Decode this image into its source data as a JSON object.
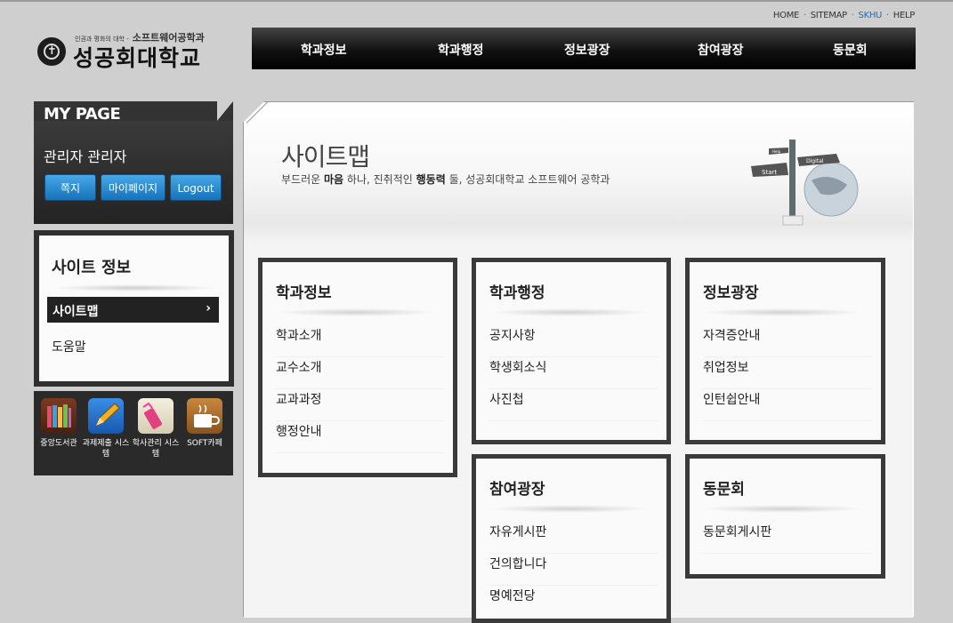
{
  "util": {
    "home": "HOME",
    "sitemap": "SITEMAP",
    "skhu": "SKHU",
    "help": "HELP",
    "sep": "·"
  },
  "logo": {
    "tagline_small": "인권과 평화의 대학 -",
    "tagline_dept": "소프트웨어공학과",
    "name": "성공회대학교"
  },
  "gnb": [
    "학과정보",
    "학과행정",
    "정보광장",
    "참여광장",
    "동문회"
  ],
  "mypage": {
    "title": "MY PAGE",
    "user": "관리자 관리자",
    "btn_note": "쪽지",
    "btn_mypage": "마이페이지",
    "btn_logout": "Logout"
  },
  "siteinfo": {
    "title": "사이트 정보",
    "active": "사이트맵",
    "chevron": "›",
    "help": "도움말"
  },
  "quick": [
    {
      "icon": "library-books-icon",
      "caption": "중앙도서관"
    },
    {
      "icon": "pencil-icon",
      "caption": "과제제출 시스템"
    },
    {
      "icon": "highlighter-icon",
      "caption": "학사관리 시스템"
    },
    {
      "icon": "coffee-cup-icon",
      "caption": "SOFT카페"
    }
  ],
  "hero": {
    "title": "사이트맵",
    "sub_prefix": "부드러운",
    "sub_b1": "마음",
    "sub_mid": "하나, 진취적인",
    "sub_b2": "행동력",
    "sub_suffix": "둘, 성공회대학교 소프트웨어 공학과",
    "sign_labels": [
      "Start",
      "Digital",
      "Help"
    ]
  },
  "categories": [
    {
      "title": "학과정보",
      "links": [
        "학과소개",
        "교수소개",
        "교과과정",
        "행정안내"
      ]
    },
    {
      "title": "학과행정",
      "links": [
        "공지사항",
        "학생회소식",
        "사진첩"
      ]
    },
    {
      "title": "정보광장",
      "links": [
        "자격증안내",
        "취업정보",
        "인턴쉽안내"
      ]
    },
    {
      "title": "참여광장",
      "links": [
        "자유게시판",
        "건의합니다",
        "명예전당"
      ]
    },
    {
      "title": "동문회",
      "links": [
        "동문회게시판"
      ]
    }
  ]
}
